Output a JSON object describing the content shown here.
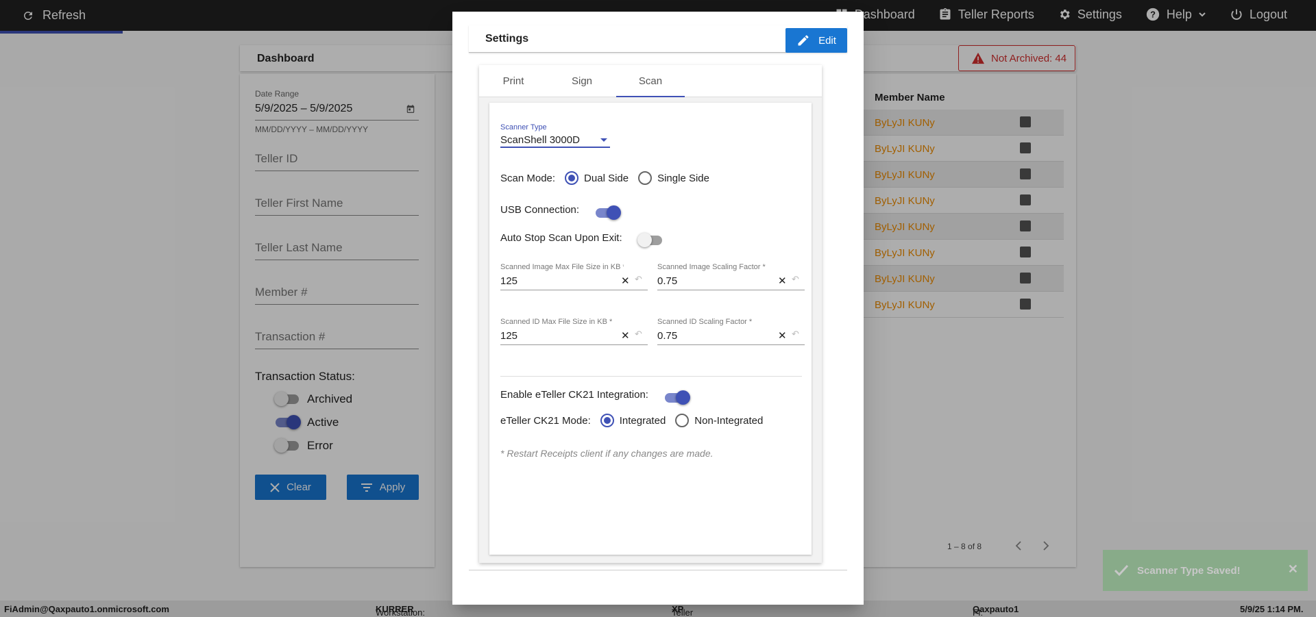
{
  "topbar": {
    "refresh_label": "Refresh",
    "nav": [
      {
        "label": "Dashboard",
        "icon": "dashboard-icon"
      },
      {
        "label": "Teller Reports",
        "icon": "clipboard-icon"
      },
      {
        "label": "Settings",
        "icon": "gear-icon"
      },
      {
        "label": "Help",
        "icon": "help-icon"
      },
      {
        "label": "Logout",
        "icon": "power-icon"
      }
    ]
  },
  "dashboard": {
    "title": "Dashboard",
    "not_archived": "Not Archived: 44",
    "filters": {
      "date_range_label": "Date Range",
      "date_range_value": "5/9/2025 – 5/9/2025",
      "date_range_hint": "MM/DD/YYYY – MM/DD/YYYY",
      "teller_id": "Teller ID",
      "teller_first_name": "Teller First Name",
      "teller_last_name": "Teller Last Name",
      "member_number": "Member #",
      "transaction_number": "Transaction #",
      "status_title": "Transaction Status:",
      "statuses": [
        {
          "label": "Archived",
          "on": false
        },
        {
          "label": "Active",
          "on": true
        },
        {
          "label": "Error",
          "on": false
        }
      ],
      "clear_label": "Clear",
      "apply_label": "Apply"
    },
    "table": {
      "column_header": "Member Name",
      "rows": [
        "ByLyJI KUNy",
        "ByLyJI KUNy",
        "ByLyJI KUNy",
        "ByLyJI KUNy",
        "ByLyJI KUNy",
        "ByLyJI KUNy",
        "ByLyJI KUNy",
        "ByLyJI KUNy"
      ],
      "pager_text": "1 – 8 of 8"
    }
  },
  "modal": {
    "title": "Settings",
    "edit_label": "Edit",
    "tabs": [
      "Print",
      "Sign",
      "Scan"
    ],
    "active_tab": "Scan",
    "scan": {
      "scanner_type_label": "Scanner Type",
      "scanner_type_value": "ScanShell 3000D",
      "scan_mode_label": "Scan Mode:",
      "scan_mode_options": [
        "Dual Side",
        "Single Side"
      ],
      "scan_mode_selected": "Dual Side",
      "usb_label": "USB Connection:",
      "usb_on": true,
      "auto_stop_label": "Auto Stop Scan Upon Exit:",
      "auto_stop_on": false,
      "fields": {
        "image_max_label": "Scanned Image Max File Size in KB *",
        "image_max_value": "125",
        "image_scale_label": "Scanned Image Scaling Factor *",
        "image_scale_value": "0.75",
        "id_max_label": "Scanned ID Max File Size in KB *",
        "id_max_value": "125",
        "id_scale_label": "Scanned ID Scaling Factor *",
        "id_scale_value": "0.75"
      },
      "ck21_label": "Enable eTeller CK21 Integration:",
      "ck21_on": true,
      "ck21_mode_label": "eTeller CK21 Mode:",
      "ck21_mode_options": [
        "Integrated",
        "Non-Integrated"
      ],
      "ck21_mode_selected": "Integrated",
      "restart_note": "* Restart Receipts client if any changes are made."
    }
  },
  "toast": {
    "message": "Scanner Type Saved!"
  },
  "footer": {
    "user": "FiAdmin@Qaxpauto1.onmicrosoft.com",
    "workstation_label": "Workstation:",
    "workstation_value": "KURRER",
    "platform_label": "Teller Platform:",
    "platform_value": "XP",
    "fi_label": "FI:",
    "fi_value": "Qaxpauto1",
    "datetime": "5/9/25 1:14 PM."
  },
  "colors": {
    "accent": "#3f51b5",
    "button_blue": "#1976d2",
    "link_orange": "#ef8c00",
    "alert_red": "#d32f2f",
    "topbar": "#212121"
  }
}
